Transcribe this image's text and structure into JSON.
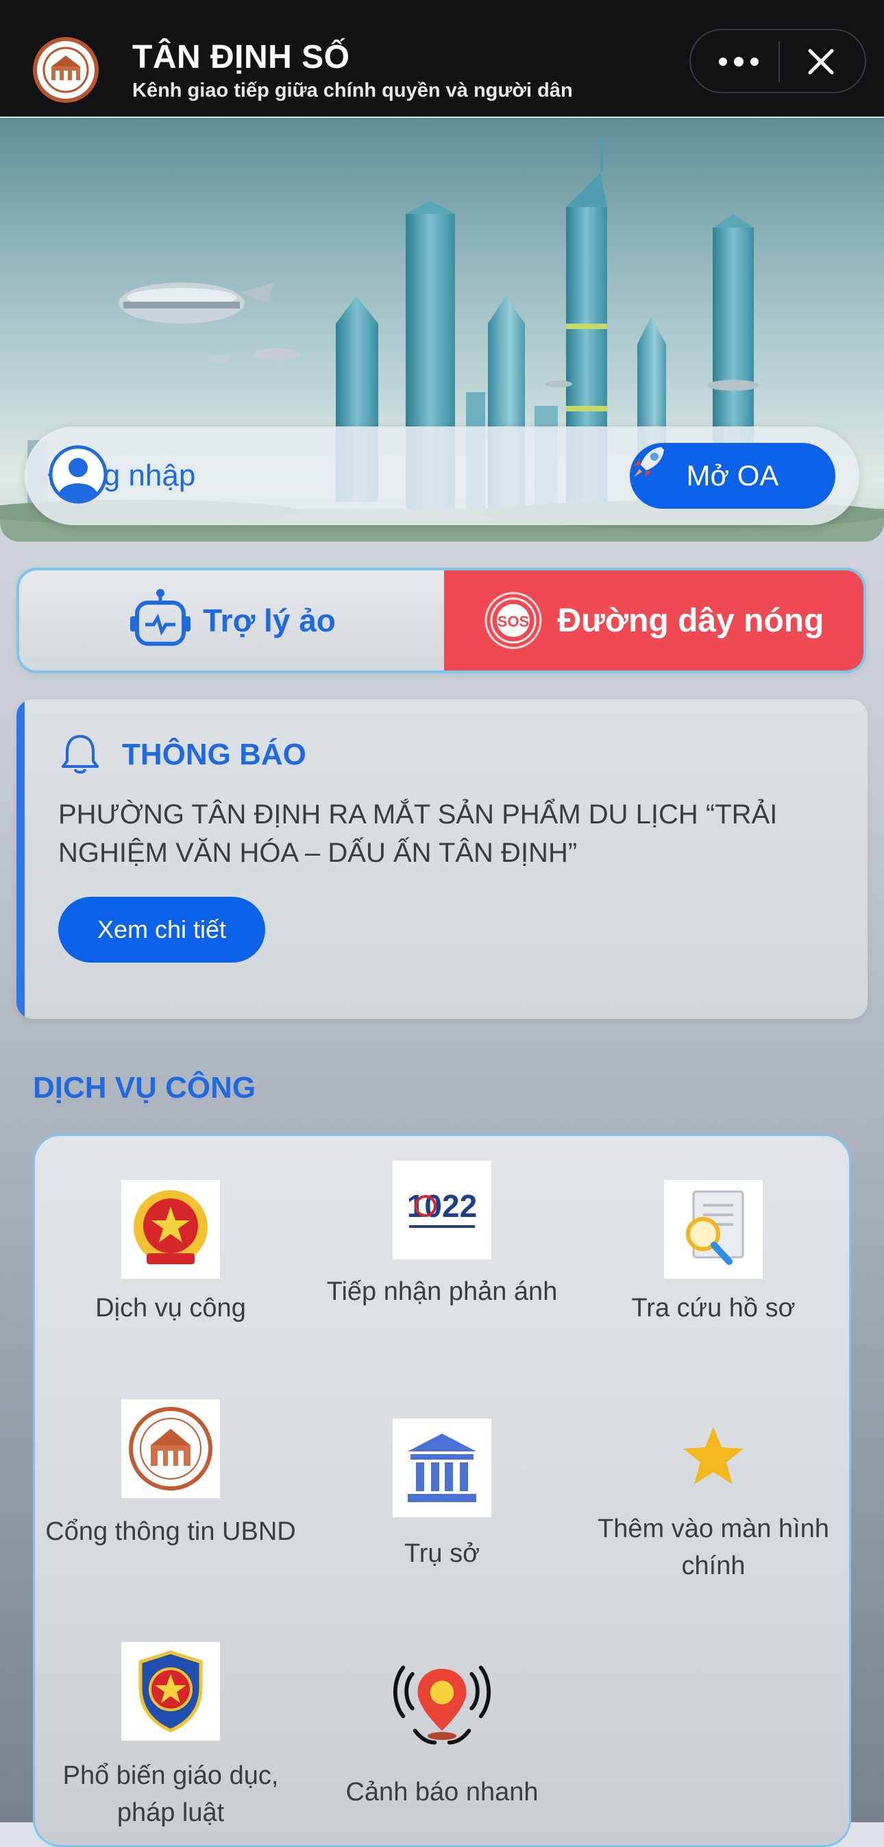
{
  "header": {
    "title": "TÂN ĐỊNH SỐ",
    "subtitle": "Kênh giao tiếp giữa chính quyền và người dân"
  },
  "hero": {
    "login_label": "Đăng nhập",
    "oa_button": "Mở OA"
  },
  "quick_actions": {
    "assistant_label": "Trợ lý ảo",
    "hotline_label": "Đường dây nóng",
    "hotline_color": "#ef4a54"
  },
  "notice": {
    "title": "THÔNG BÁO",
    "body": "PHƯỜNG TÂN ĐỊNH RA MẮT SẢN PHẨM DU LỊCH “TRẢI NGHIỆM VĂN HÓA – DẤU ẤN TÂN ĐỊNH”",
    "button": "Xem chi tiết"
  },
  "services": {
    "heading": "DỊCH VỤ CÔNG",
    "items": [
      {
        "label": "Dịch vụ công",
        "icon": "national-emblem-icon"
      },
      {
        "label": "Tiếp nhận phản ánh",
        "icon": "hotline-1022-icon",
        "badge_text": "1022"
      },
      {
        "label": "Tra cứu hồ sơ",
        "icon": "document-search-icon"
      },
      {
        "label": "Cổng thông tin UBND",
        "icon": "ward-seal-icon"
      },
      {
        "label": "Trụ sở",
        "icon": "building-icon"
      },
      {
        "label": "Thêm vào màn hình chính",
        "icon": "star-icon"
      },
      {
        "label": "Phổ biến giáo dục, pháp luật",
        "icon": "police-badge-icon"
      },
      {
        "label": "Cảnh báo nhanh",
        "icon": "alert-pin-icon"
      }
    ]
  },
  "colors": {
    "accent": "#1f6ae0",
    "button": "#0b62e8",
    "border": "#7cc6ee"
  }
}
